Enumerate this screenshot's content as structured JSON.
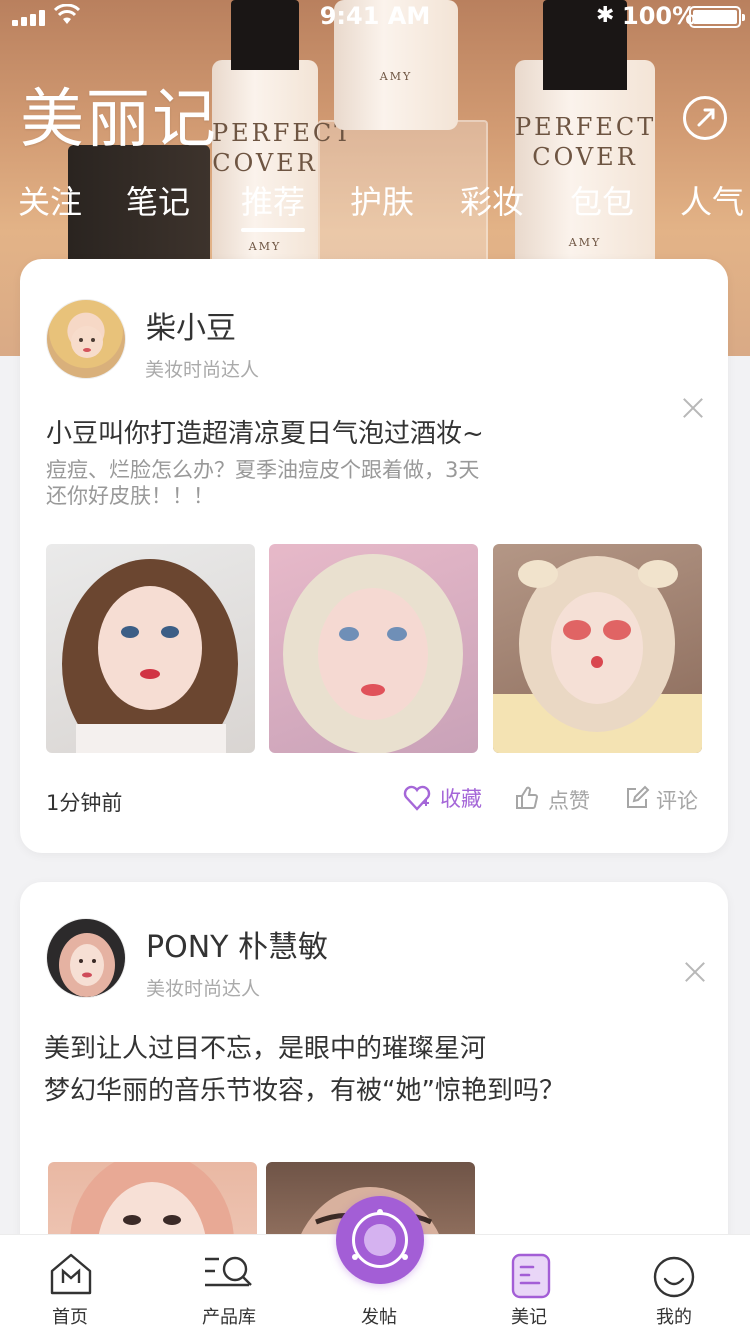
{
  "status_bar": {
    "time": "9:41 AM",
    "battery": "100%"
  },
  "header": {
    "title": "美丽记",
    "banner_brand": "PERFECT COVER",
    "banner_small": "AMY",
    "tabs": [
      {
        "label": "关注",
        "active": false
      },
      {
        "label": "笔记",
        "active": false
      },
      {
        "label": "推荐",
        "active": true
      },
      {
        "label": "护肤",
        "active": false
      },
      {
        "label": "彩妆",
        "active": false
      },
      {
        "label": "包包",
        "active": false
      },
      {
        "label": "人气",
        "active": false
      }
    ]
  },
  "feed": [
    {
      "author": "柴小豆",
      "tag": "美妆时尚达人",
      "title": "小豆叫你打造超清凉夏日气泡过酒妆~",
      "desc_lines": [
        "痘痘、烂脸怎么办？夏季油痘皮个跟着做，3天",
        "还你好皮肤！！！"
      ],
      "time": "1分钟前",
      "actions": {
        "favorite": "收藏",
        "like": "点赞",
        "comment": "评论"
      }
    },
    {
      "author": "PONY   朴慧敏",
      "tag": "美妆时尚达人",
      "lines": [
        "美到让人过目不忘，是眼中的璀璨星河",
        "梦幻华丽的音乐节妆容，有被“她”惊艳到吗？"
      ]
    }
  ],
  "bottom_nav": {
    "items": [
      {
        "label": "首页",
        "icon": "home-icon"
      },
      {
        "label": "产品库",
        "icon": "product-search-icon"
      },
      {
        "label": "发帖",
        "icon": "post-icon"
      },
      {
        "label": "美记",
        "icon": "notes-icon",
        "active": true
      },
      {
        "label": "我的",
        "icon": "profile-icon"
      }
    ]
  },
  "colors": {
    "accent": "#a35ed6",
    "favorite": "#a567d8"
  }
}
